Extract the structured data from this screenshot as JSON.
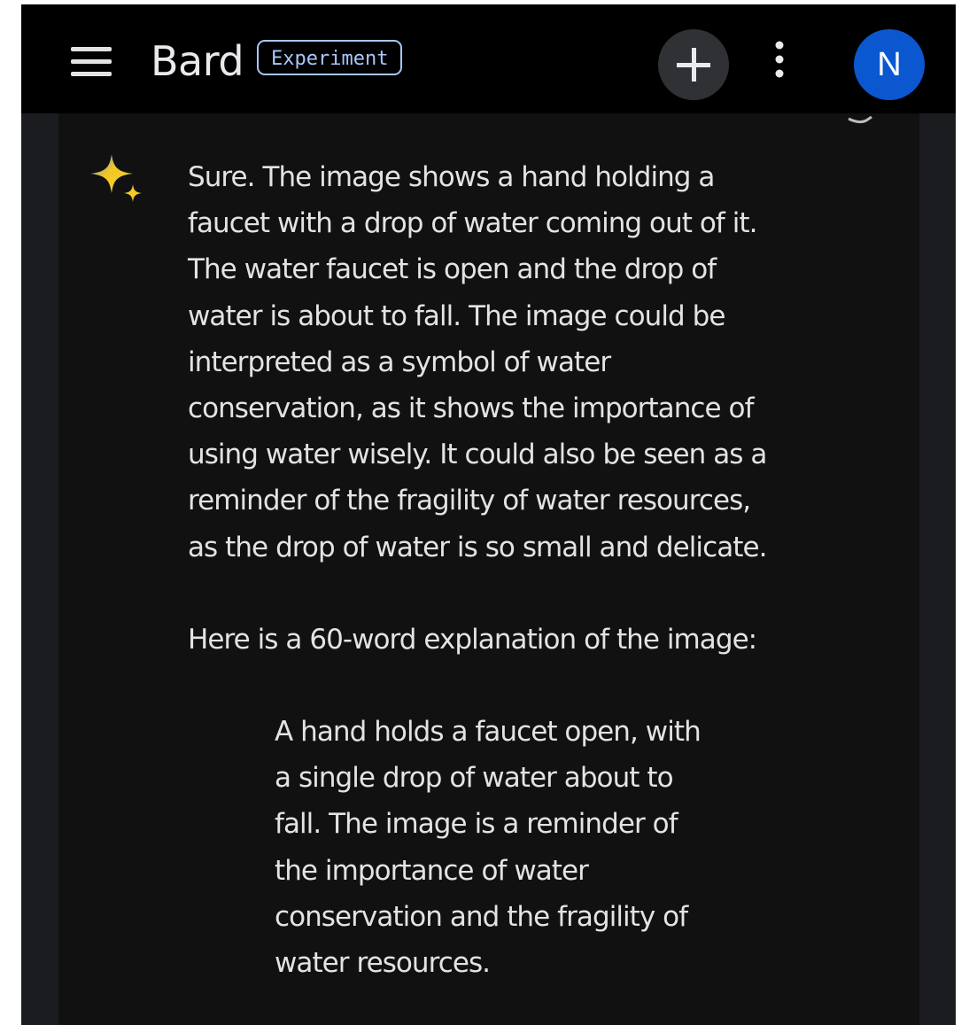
{
  "header": {
    "app_name": "Bard",
    "badge": "Experiment",
    "avatar_initial": "N",
    "colors": {
      "avatar_bg": "#0b57d0",
      "badge_border": "#a8c7fa"
    },
    "icons": [
      "menu-icon",
      "plus-icon",
      "more-vert-icon"
    ]
  },
  "message": {
    "icon": "sparkle-icon",
    "paragraph1": "Sure. The image shows a hand holding a\nfaucet with a drop of water coming out of it.\nThe water faucet is open and the drop of\nwater is about to fall. The image could be\ninterpreted as a symbol of water\nconservation, as it shows the importance of\nusing water wisely. It could also be seen as a\nreminder of the fragility of water resources,\nas the drop of water is so small and delicate.",
    "paragraph2": "Here is a 60-word explanation of the image:",
    "quote": "A hand holds a faucet open, with\na single drop of water about to\nfall. The image is a reminder of\nthe importance of water\nconservation and the fragility of\nwater resources."
  }
}
